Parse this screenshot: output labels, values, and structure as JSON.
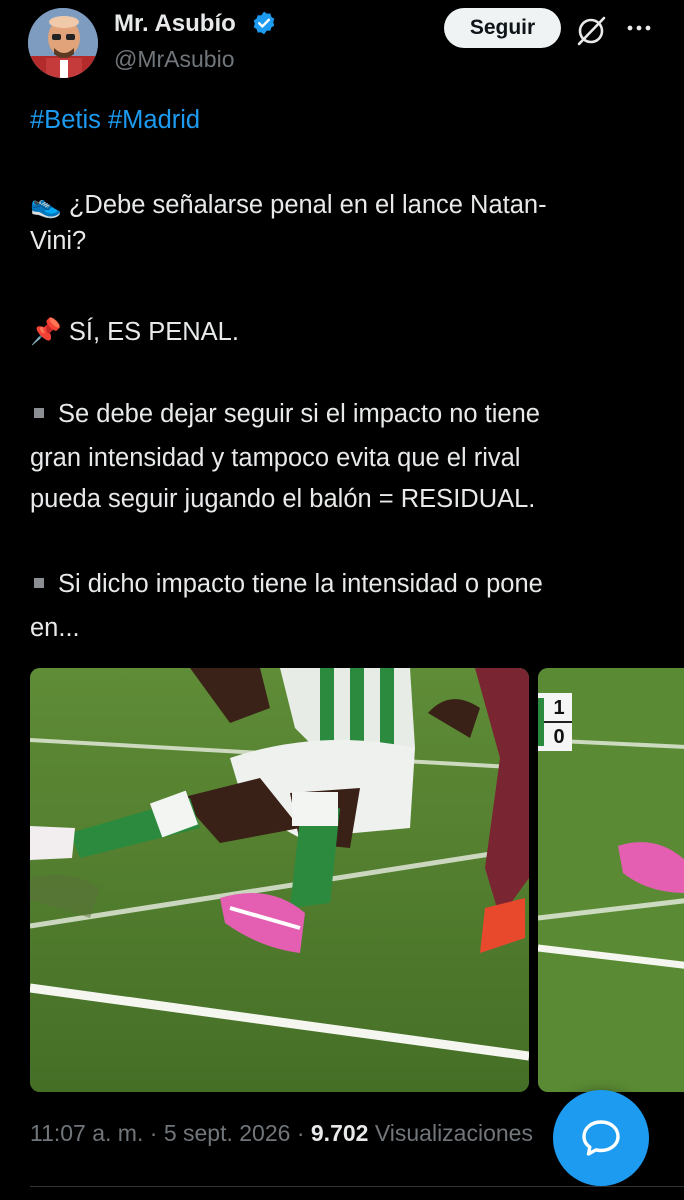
{
  "author": {
    "name": "Mr. Asubío",
    "handle": "@MrAsubio",
    "verified": true
  },
  "actions": {
    "follow_label": "Seguir",
    "grok_icon": "grok-slash-icon",
    "more_icon": "more-dots-icon"
  },
  "tweet": {
    "hashtags": [
      "#Betis",
      "#Madrid"
    ],
    "question_emoji": "👟",
    "question_line1": "¿Debe señalarse penal en el lance Natan-",
    "question_line2": "Vini?",
    "answer_emoji": "📌",
    "answer": "SÍ, ES PENAL.",
    "bullet_icon": "square-bullet-icon",
    "point1_line1": "Se debe dejar seguir si el impacto no tiene",
    "point1_line2": "gran intensidad y tampoco evita que el rival",
    "point1_line3": "pueda seguir jugando el balón = RESIDUAL.",
    "point2_line1": "Si dicho impacto tiene la intensidad o pone",
    "point2_line2": "en..."
  },
  "media": {
    "overlay_score_top": "1",
    "overlay_score_bottom": "0"
  },
  "meta": {
    "time": "11:07 a. m.",
    "sep": "·",
    "date": "5 sept. 2026",
    "views_count": "9.702",
    "views_label": "Visualizaciones"
  },
  "colors": {
    "accent": "#1d9bf0",
    "background": "#000000",
    "text": "#e7e9ea",
    "muted": "#71767b"
  }
}
